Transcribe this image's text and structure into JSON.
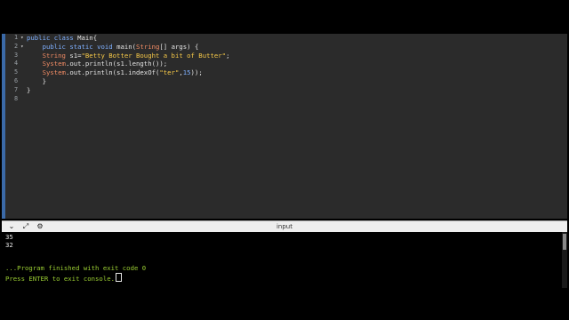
{
  "editor": {
    "gutter": [
      "1",
      "2",
      "3",
      "4",
      "5",
      "6",
      "7",
      "8"
    ],
    "lines": [
      {
        "t": "public class Main{"
      },
      {
        "t": "    public static void main(String[] args) {"
      },
      {
        "t": "    String s1=\"Betty Botter Bought a bit of Butter\";"
      },
      {
        "t": "    System.out.println(s1.length());"
      },
      {
        "t": "    System.out.println(s1.indexOf(\"ter\",15));"
      },
      {
        "t": "    }"
      },
      {
        "t": "}"
      },
      {
        "t": ""
      }
    ],
    "tokens": {
      "l1_kw1": "public",
      "l1_kw2": "class",
      "l1_rest": " Main{",
      "l2_kw1": "public",
      "l2_kw2": "static",
      "l2_kw3": "void",
      "l2_rest1": " main(",
      "l2_cls": "String",
      "l2_rest2": "[] args) {",
      "l3_cls": "String",
      "l3_rest1": " s1=",
      "l3_str": "\"Betty Botter Bought a bit of Butter\"",
      "l3_rest2": ";",
      "l4_cls": "System",
      "l4_rest": ".out.println(s1.length());",
      "l5_cls": "System",
      "l5_rest1": ".out.println(s1.indexOf(",
      "l5_str": "\"ter\"",
      "l5_rest2": ",",
      "l5_num": "15",
      "l5_rest3": "));",
      "l6": "    }",
      "l7": "}"
    },
    "fold_markers": [
      "▾",
      "▾"
    ]
  },
  "io": {
    "title": "input",
    "toolbar_icons": [
      "chevron-down-icon",
      "expand-icon",
      "settings-icon"
    ],
    "toolbar_glyphs": [
      "⌄",
      "⤢",
      "⚙"
    ],
    "output": [
      "35",
      "32",
      "",
      "",
      "...Program finished with exit code 0",
      "Press ENTER to exit console."
    ]
  }
}
